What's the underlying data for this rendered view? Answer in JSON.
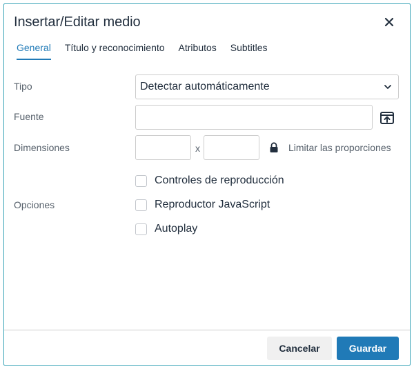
{
  "dialog": {
    "title": "Insertar/Editar medio",
    "close_icon": "close-icon"
  },
  "tabs": [
    {
      "label": "General",
      "active": true
    },
    {
      "label": "Título y reconocimiento",
      "active": false
    },
    {
      "label": "Atributos",
      "active": false
    },
    {
      "label": "Subtitles",
      "active": false
    }
  ],
  "form": {
    "tipo": {
      "label": "Tipo",
      "selected": "Detectar automáticamente"
    },
    "fuente": {
      "label": "Fuente",
      "value": "",
      "upload_icon": "upload-icon"
    },
    "dimensiones": {
      "label": "Dimensiones",
      "width": "",
      "height": "",
      "separator": "x",
      "lock_icon": "lock-icon",
      "lock_label": "Limitar las proporciones"
    },
    "opciones": {
      "label": "Opciones",
      "items": [
        {
          "label": "Controles de reproducción",
          "checked": false
        },
        {
          "label": "Reproductor JavaScript",
          "checked": false
        },
        {
          "label": "Autoplay",
          "checked": false
        }
      ]
    }
  },
  "footer": {
    "cancel_label": "Cancelar",
    "save_label": "Guardar"
  },
  "colors": {
    "accent": "#207ab7",
    "dialog_border": "#3aa4b8",
    "text": "#222f3e",
    "muted_text": "#555f6a"
  }
}
